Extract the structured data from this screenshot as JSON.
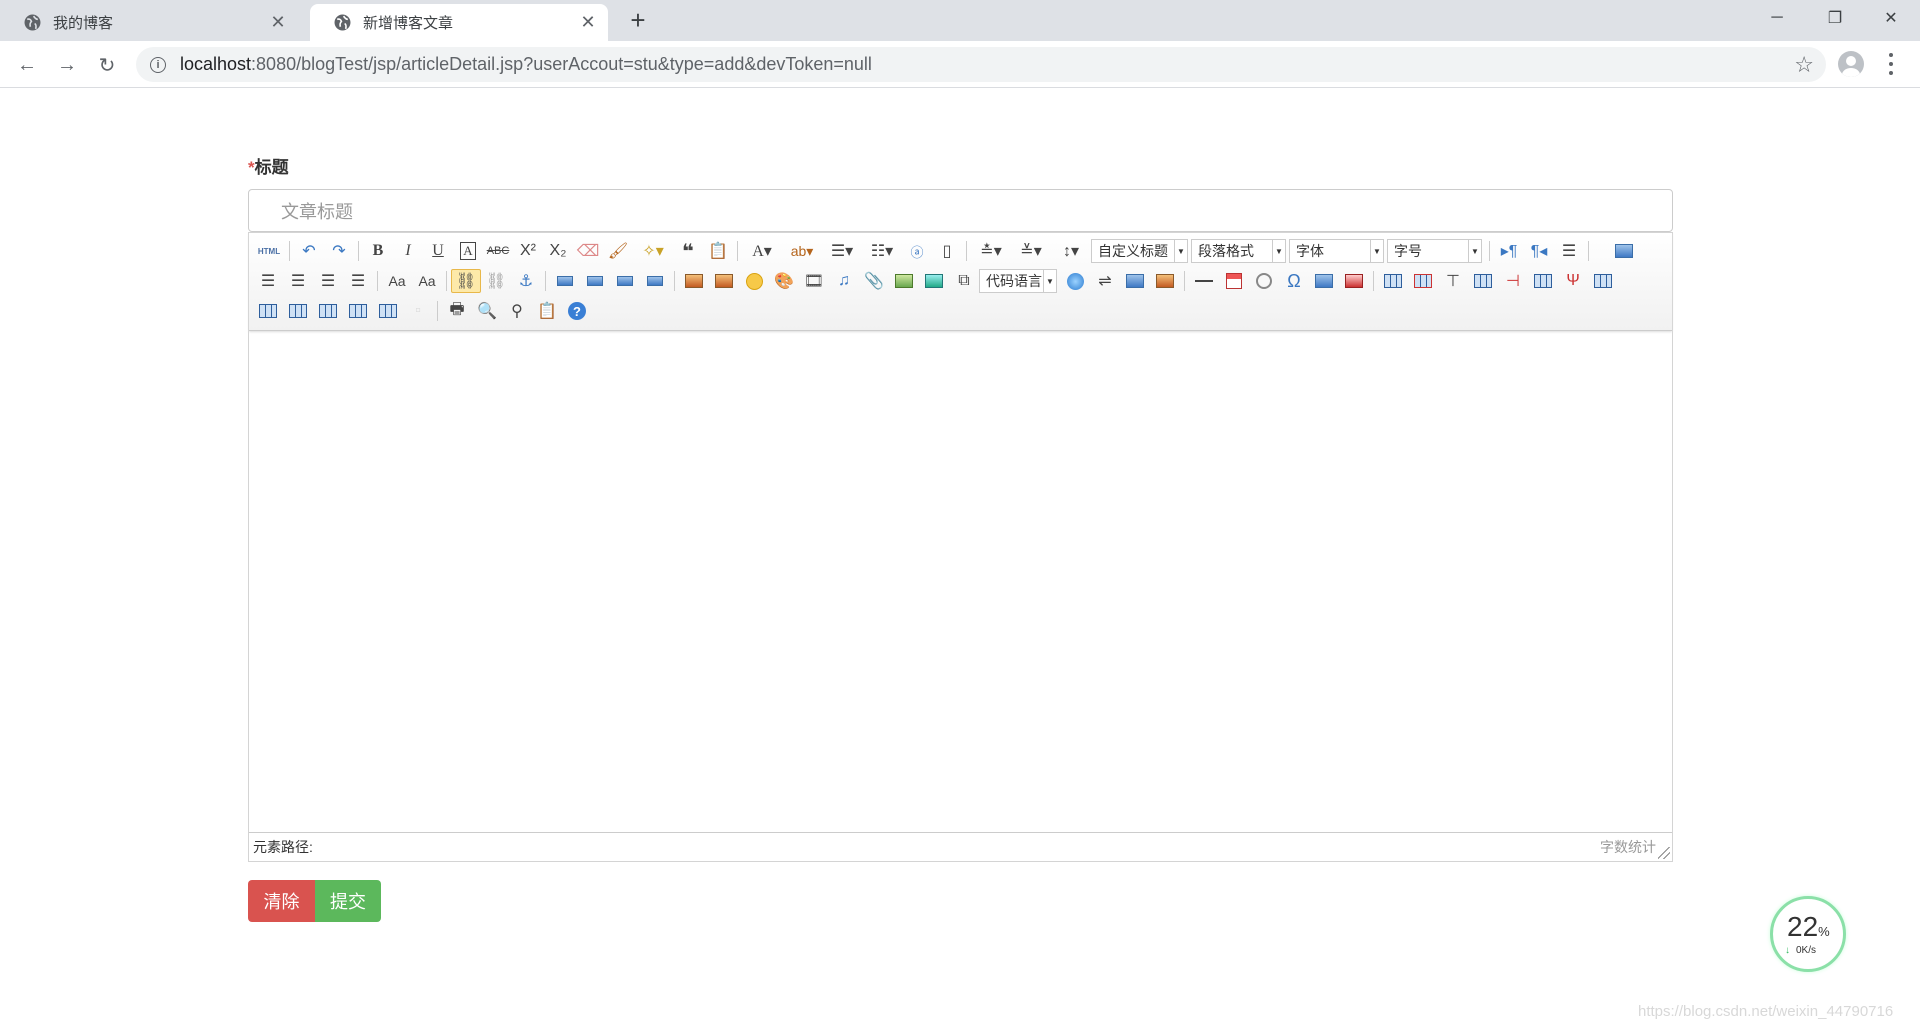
{
  "browser": {
    "tabs": [
      {
        "label": "我的博客",
        "active": false
      },
      {
        "label": "新增博客文章",
        "active": true
      }
    ],
    "new_tab": "+",
    "url_host": "localhost",
    "url_path": ":8080/blogTest/jsp/articleDetail.jsp?userAccout=stu&type=add&devToken=null"
  },
  "form": {
    "required_mark": "*",
    "title_label": "标题",
    "title_placeholder": "文章标题"
  },
  "toolbar": {
    "html_label": "HTML",
    "dropdowns": {
      "custom_title": "自定义标题",
      "paragraph": "段落格式",
      "font_family": "字体",
      "font_size": "字号",
      "code_language": "代码语言"
    }
  },
  "editor": {
    "element_path_label": "元素路径:",
    "word_count_label": "字数统计"
  },
  "actions": {
    "clear": "清除",
    "submit": "提交"
  },
  "speed_widget": {
    "percent": "22",
    "percent_sign": "%",
    "rate": "0K/s"
  },
  "watermark": "https://blog.csdn.net/weixin_44790716",
  "colors": {
    "danger": "#d9534f",
    "success": "#5cb85c"
  }
}
